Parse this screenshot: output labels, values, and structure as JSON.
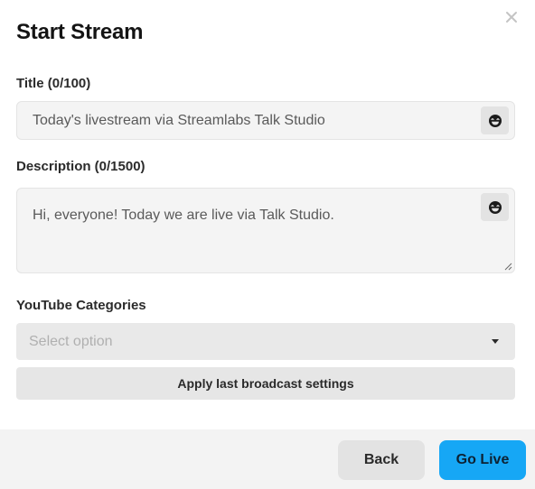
{
  "modal": {
    "title": "Start Stream",
    "close_icon": "close-icon"
  },
  "fields": {
    "title_label": "Title (0/100)",
    "title_placeholder": "Today's livestream via Streamlabs Talk Studio",
    "description_label": "Description (0/1500)",
    "description_placeholder": "Hi, everyone! Today we are live via Talk Studio.",
    "emoji_icon": "emoji-icon",
    "category_label": "YouTube Categories",
    "category_placeholder": "Select option"
  },
  "actions": {
    "apply_label": "Apply last broadcast settings",
    "back_label": "Back",
    "go_live_label": "Go Live"
  },
  "colors": {
    "primary": "#16a7f5",
    "surface": "#f4f4f4",
    "footer": "#f3f3f3"
  }
}
